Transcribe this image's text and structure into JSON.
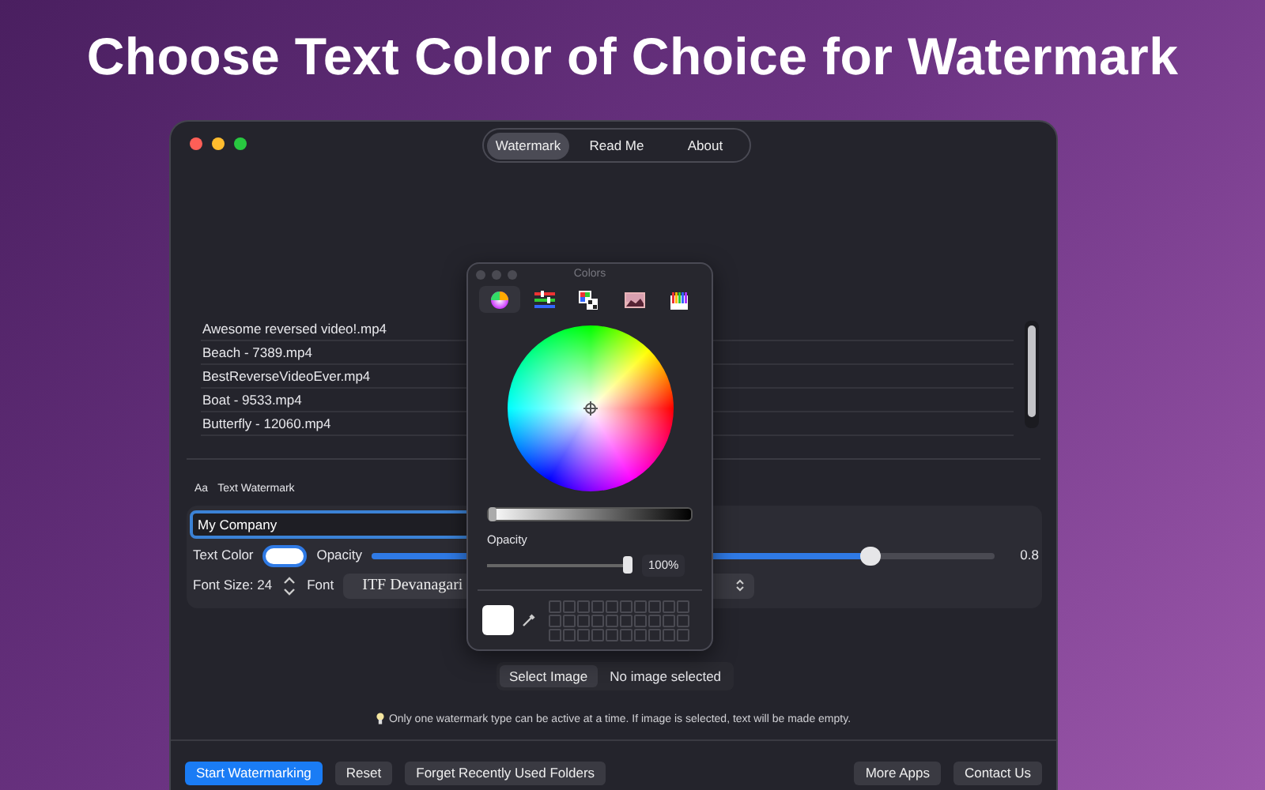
{
  "headline": "Choose Text Color of Choice for Watermark",
  "tabs": [
    {
      "label": "Watermark",
      "selected": true
    },
    {
      "label": "Read Me",
      "selected": false
    },
    {
      "label": "About",
      "selected": false
    }
  ],
  "files": [
    "Awesome reversed video!.mp4",
    "Beach - 7389.mp4",
    "BestReverseVideoEver.mp4",
    "Boat - 9533.mp4",
    "Butterfly - 12060.mp4"
  ],
  "text_watermark": {
    "icon_text": "Aa",
    "label": "Text Watermark",
    "text_value": "My Company",
    "text_color_label": "Text Color",
    "opacity_label": "Opacity",
    "opacity": {
      "level": 0.8
    },
    "opacity_reading": "0.8",
    "font_size": "Font Size: 24",
    "font_label": "Font",
    "font": "ITF Devanagari"
  },
  "image_watermark": {
    "button": "Select Image",
    "status": "No image selected"
  },
  "hint": "Only one watermark type can be active at a time. If image is selected, text will be made empty.",
  "left_buttons": [
    {
      "label": "Start Watermarking",
      "primary": true
    },
    {
      "label": "Reset",
      "primary": false
    },
    {
      "label": "Forget Recently Used Folders",
      "primary": false
    }
  ],
  "right_buttons": [
    {
      "label": "More Apps",
      "primary": false
    },
    {
      "label": "Contact Us",
      "primary": false
    }
  ],
  "colors_panel": {
    "title": "Colors",
    "modes": [
      {
        "kind": "wheel",
        "selected": true
      },
      {
        "kind": "sliders",
        "selected": false
      },
      {
        "kind": "palettes",
        "selected": false
      },
      {
        "kind": "image",
        "selected": false
      },
      {
        "kind": "pencils",
        "selected": false
      }
    ],
    "brightness": {
      "level": 0
    },
    "opacity_label": "Opacity",
    "opacity": {
      "level": 1
    },
    "opacity_reading": "100%"
  }
}
